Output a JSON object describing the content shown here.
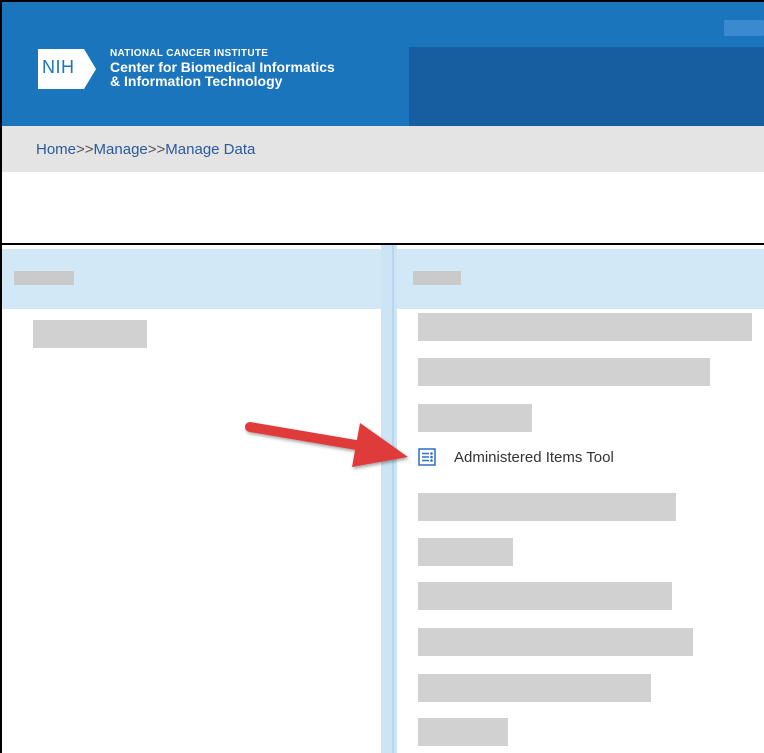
{
  "header": {
    "logo_badge": "NIH",
    "logo_line1": "NATIONAL CANCER INSTITUTE",
    "logo_line2": "Center for Biomedical Informatics",
    "logo_line3": "& Information Technology",
    "color_primary": "#1b75bc",
    "color_secondary": "#175ea0"
  },
  "breadcrumb": {
    "items": [
      "Home",
      "Manage",
      "Manage Data"
    ],
    "separator": ">>"
  },
  "right_panel": {
    "highlighted_item": {
      "label": "Administered Items Tool",
      "icon": "list-tree-icon"
    }
  },
  "annotation": {
    "arrow_color": "#e03a3a"
  }
}
